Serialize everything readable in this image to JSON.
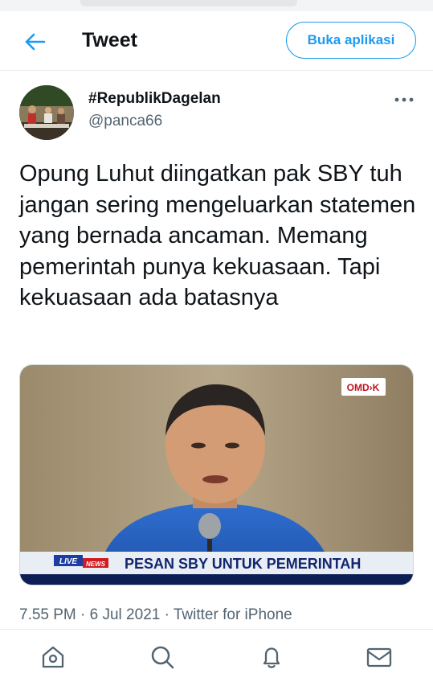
{
  "header": {
    "title": "Tweet",
    "open_app_label": "Buka aplikasi",
    "back_icon": "arrow-left-icon"
  },
  "tweet": {
    "display_name": "#RepublikDagelan",
    "handle": "@panca66",
    "text": "Opung Luhut diingatkan pak SBY tuh jangan sering mengeluarkan statemen yang bernada ancaman. Memang pemerintah punya kekuasaan. Tapi kekuasaan ada batasnya",
    "timestamp": "7.55 PM · 6 Jul 2021 · Twitter for iPhone",
    "media": {
      "channel_logo": "OMD›K",
      "live_badge": "LIVE",
      "news_badge": "NEWS",
      "caption": "PESAN SBY UNTUK PEMERINTAH"
    }
  },
  "bottom_nav": {
    "items": [
      "home-icon",
      "search-icon",
      "bell-icon",
      "mail-icon"
    ]
  },
  "colors": {
    "accent": "#1d9bf0",
    "text_primary": "#0f1419",
    "text_secondary": "#536471",
    "border": "#e6ecf0"
  }
}
